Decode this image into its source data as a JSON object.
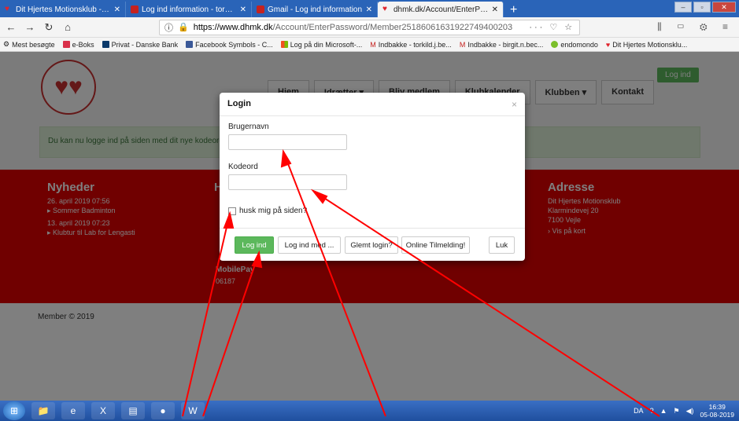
{
  "browser": {
    "tabs": [
      {
        "title": "Dit Hjertes Motionsklub - moti",
        "icon": "heart-icon"
      },
      {
        "title": "Log ind information - torkild.j",
        "icon": "mail-icon"
      },
      {
        "title": "Gmail - Log ind information",
        "icon": "mail-icon"
      },
      {
        "title": "dhmk.dk/Account/EnterPassw",
        "icon": "heart-icon"
      }
    ],
    "url_host": "https://www.dhmk.dk",
    "url_path": "/Account/EnterPassword/Member25186061631922749400203",
    "url_actions": "··· ♡ ☆",
    "bookmarks": [
      "Mest besøgte",
      "e-Boks",
      "Privat - Danske Bank",
      "Facebook Symbols - C...",
      "Log på din Microsoft-...",
      "Indbakke - torkild.j.be...",
      "Indbakke - birgit.n.bec...",
      "endomondo",
      "Dit Hjertes Motionsklu..."
    ]
  },
  "site": {
    "login_top": "Log ind",
    "nav": [
      "Hjem",
      "Idrætter ▾",
      "Bliv medlem",
      "Klubkalender",
      "Klubben ▾",
      "Kontakt"
    ],
    "alert": "Du kan nu logge ind på siden med dit nye kodeord",
    "news_title": "Nyheder",
    "news": [
      {
        "date": "26. april 2019 07:56",
        "title": "▸ Sommer Badminton"
      },
      {
        "date": "13. april 2019 07:23",
        "title": "▸ Klubtur til Lab for Lengasti"
      }
    ],
    "col2_title": "H",
    "mobilepay_title": "MobilePay",
    "mobilepay_number": "06187",
    "address_title": "Adresse",
    "address_lines": [
      "Dit Hjertes Motionsklub",
      "Klarmindevej 20",
      "7100 Vejle",
      "› Vis på kort"
    ],
    "footer": "Member © 2019"
  },
  "modal": {
    "title": "Login",
    "close": "×",
    "username_label": "Brugernavn",
    "username_value": "",
    "password_label": "Kodeord",
    "password_value": "",
    "remember_label": "husk mig på siden?",
    "buttons": {
      "login": "Log ind",
      "login_with": "Log ind med ...",
      "forgot": "Glemt login?",
      "signup": "Online Tilmelding!",
      "close": "Luk"
    }
  },
  "taskbar": {
    "lang": "DA",
    "time": "16:39",
    "date": "05-08-2019"
  },
  "colors": {
    "annotation_arrow": "#ff0000",
    "primary_button": "#5cb85c",
    "footer_band": "#e00000"
  }
}
